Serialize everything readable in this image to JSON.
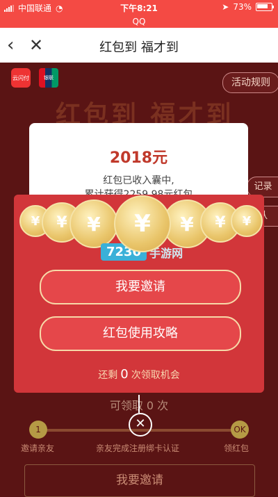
{
  "status_bar": {
    "carrier": "中国联通",
    "time": "下午8:21",
    "battery": "73%"
  },
  "app_bar": {
    "label": "QQ"
  },
  "nav": {
    "title": "红包到 福才到",
    "back_icon": "back-chevron-icon",
    "close_icon": "close-x-icon"
  },
  "header": {
    "logo1": "云闪付",
    "logo2": "银联",
    "rules_label": "活动规则",
    "big_title": "红包到 福才到"
  },
  "side_buttons": [
    {
      "label": "记录"
    },
    {
      "label": "队"
    }
  ],
  "modal": {
    "amount": "2018元",
    "message1": "红包已收入囊中,",
    "message2": "累计获得2259.98元红包",
    "coin_symbol": "¥",
    "watermark_number": "7230",
    "watermark_text": "手游网",
    "invite_button": "我要邀请",
    "guide_button": "红包使用攻略",
    "remain_prefix": "还剩",
    "remain_count": "0",
    "remain_suffix": "次领取机会"
  },
  "background": {
    "receive_text": "可领取 0 次",
    "steps": [
      {
        "badge": "1",
        "label": "邀请亲友"
      },
      {
        "badge": "",
        "label": "亲友完成注册绑卡认证"
      },
      {
        "badge": "OK",
        "label": "领红包"
      }
    ],
    "bottom_button": "我要邀请"
  },
  "colors": {
    "accent_red": "#d2363a",
    "button_red": "#e5474a",
    "gold": "#e9c56a",
    "dark_bg": "#5a1414"
  }
}
